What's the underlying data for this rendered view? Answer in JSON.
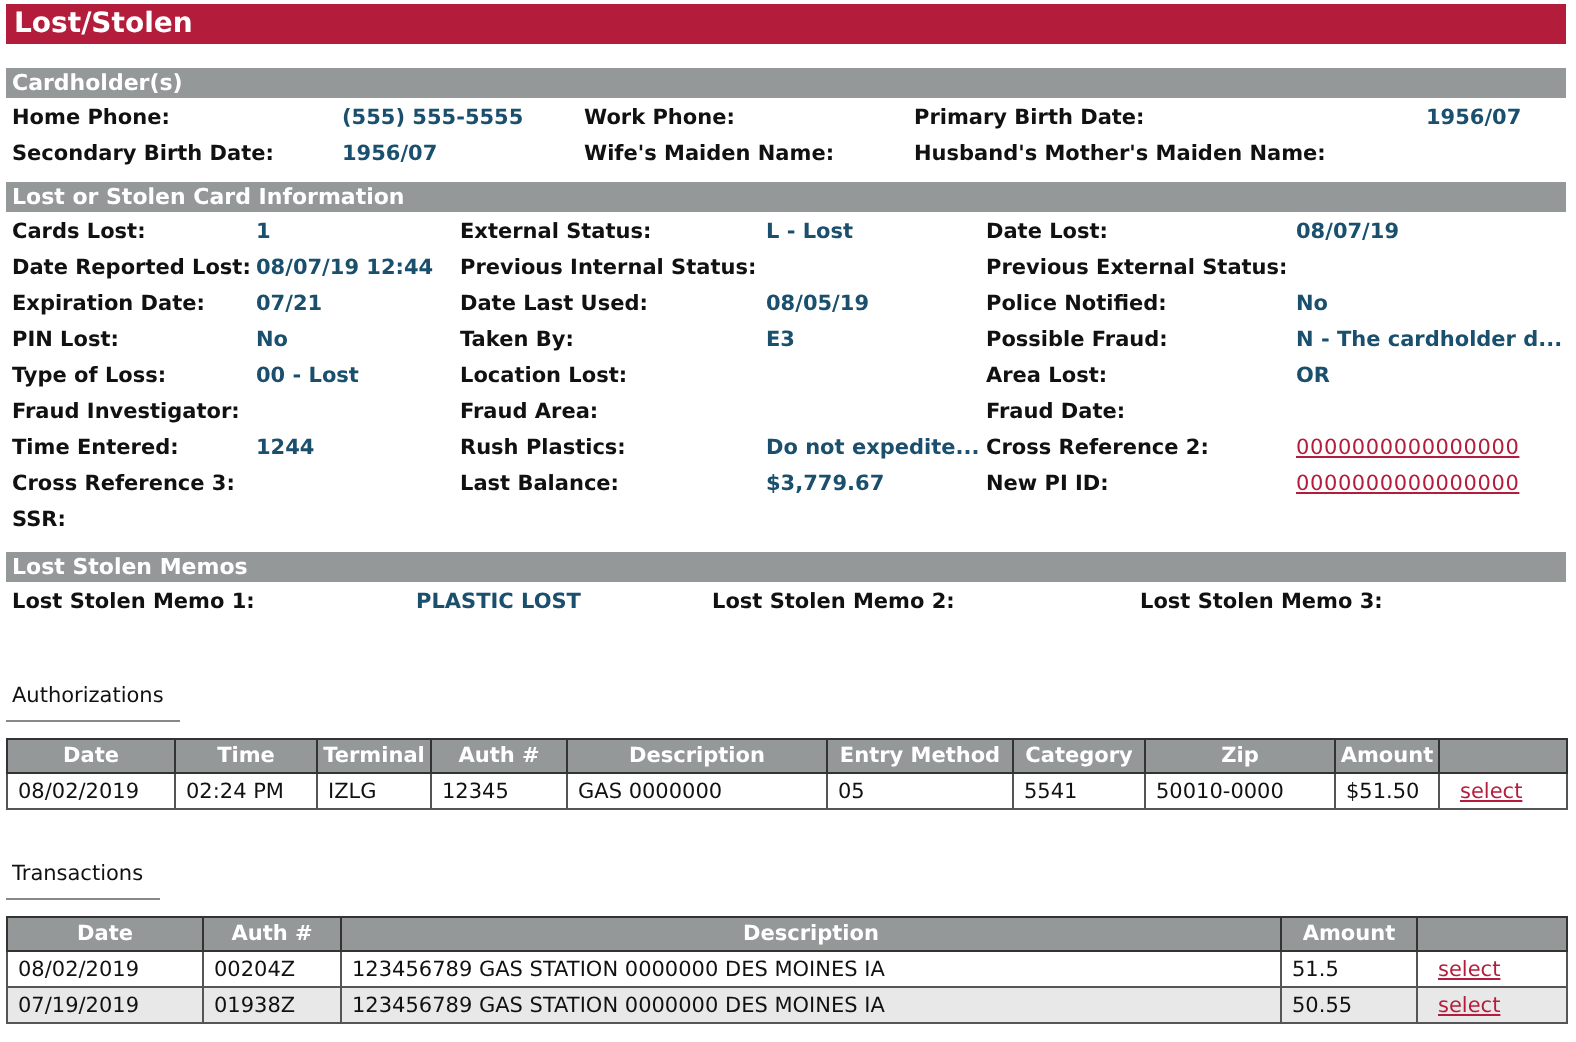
{
  "title": "Lost/Stolen",
  "sections": [
    {
      "kind": "cardholder",
      "title": "Cardholder(s)",
      "fields": [
        {
          "label": "Home Phone:",
          "value": "(555) 555-5555",
          "kind": "text"
        },
        {
          "label": "Work Phone:"
        },
        {
          "label": "Primary Birth Date:",
          "value": "1956/07",
          "kind": "text"
        },
        {
          "label": "Secondary Birth Date:",
          "value": "1956/07",
          "kind": "text"
        },
        {
          "label": "Wife's Maiden Name:"
        },
        {
          "label": "Husband's Mother's Maiden Name:"
        }
      ]
    },
    {
      "kind": "card_info",
      "title": "Lost or Stolen Card Information",
      "fields": [
        {
          "label": "Cards Lost:",
          "value": "1",
          "kind": "text"
        },
        {
          "label": "External Status:",
          "value": "L - Lost",
          "kind": "text"
        },
        {
          "label": "Date Lost:",
          "value": "08/07/19",
          "kind": "text"
        },
        {
          "label": "Date Reported Lost:",
          "value": "08/07/19 12:44",
          "kind": "text"
        },
        {
          "label": "Previous Internal Status:"
        },
        {
          "label": "Previous External Status:"
        },
        {
          "label": "Expiration Date:",
          "value": "07/21",
          "kind": "text"
        },
        {
          "label": "Date Last Used:",
          "value": "08/05/19",
          "kind": "text"
        },
        {
          "label": "Police Notified:",
          "value": "No",
          "kind": "text"
        },
        {
          "label": "PIN Lost:",
          "value": "No",
          "kind": "text"
        },
        {
          "label": "Taken By:",
          "value": "E3",
          "kind": "text"
        },
        {
          "label": "Possible Fraud:",
          "value": "N - The cardholder d...",
          "kind": "text"
        },
        {
          "label": "Type of Loss:",
          "value": "00 - Lost",
          "kind": "text"
        },
        {
          "label": "Location Lost:"
        },
        {
          "label": "Area Lost:",
          "value": "OR",
          "kind": "text"
        },
        {
          "label": "Fraud Investigator:"
        },
        {
          "label": "Fraud Area:"
        },
        {
          "label": "Fraud Date:"
        },
        {
          "label": "Time Entered:",
          "value": "1244",
          "kind": "text"
        },
        {
          "label": "Rush Plastics:",
          "value": "Do not expedite...",
          "kind": "text"
        },
        {
          "label": "Cross Reference 2:",
          "value": "0000000000000000",
          "kind": "link"
        },
        {
          "label": "Cross Reference 3:"
        },
        {
          "label": "Last Balance:",
          "value": "$3,779.67",
          "kind": "text"
        },
        {
          "label": "New PI ID:",
          "value": "0000000000000000",
          "kind": "link"
        },
        {
          "label": "SSR:"
        }
      ]
    },
    {
      "kind": "memos",
      "title": "Lost Stolen Memos",
      "fields": [
        {
          "label": "Lost Stolen Memo 1:",
          "value": "PLASTIC LOST",
          "kind": "text"
        },
        {
          "label": "Lost Stolen Memo 2:"
        },
        {
          "label": "Lost Stolen Memo 3:"
        }
      ]
    }
  ],
  "tables": [
    {
      "kind": "authorizations",
      "title": "Authorizations",
      "columns": [
        "Date",
        "Time",
        "Terminal",
        "Auth #",
        "Description",
        "Entry Method",
        "Category",
        "Zip",
        "Amount"
      ],
      "rows": [
        {
          "cells": [
            "08/02/2019",
            "02:24 PM",
            "IZLG",
            "12345",
            "GAS 0000000",
            "05",
            "5541",
            "50010-0000",
            "$51.50"
          ],
          "action": "select"
        }
      ]
    },
    {
      "kind": "transactions",
      "title": "Transactions",
      "columns": [
        "Date",
        "Auth #",
        "Description",
        "Amount"
      ],
      "rows": [
        {
          "cells": [
            "08/02/2019",
            "00204Z",
            "123456789 GAS STATION 0000000 DES MOINES IA",
            "51.5"
          ],
          "action": "select"
        },
        {
          "cells": [
            "07/19/2019",
            "01938Z",
            "123456789 GAS STATION 0000000 DES MOINES IA",
            "50.55"
          ],
          "action": "select"
        }
      ]
    }
  ]
}
